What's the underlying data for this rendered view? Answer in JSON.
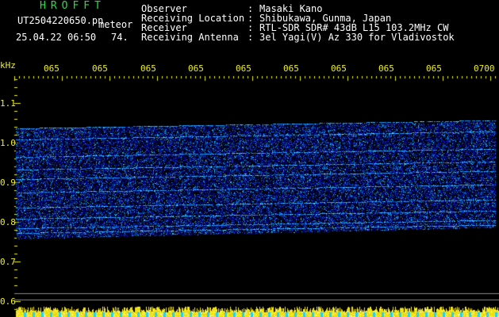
{
  "header": {
    "title": "HROFFT",
    "filename": "UT2504220650.pn",
    "mode": "meteor",
    "datetime": "25.04.22 06:50",
    "count": "74."
  },
  "info": [
    {
      "label": "Observer",
      "value": "Masaki Kano"
    },
    {
      "label": "Receiving Location",
      "value": "Shibukawa, Gunma, Japan"
    },
    {
      "label": "Receiver",
      "value": "RTL-SDR SDR# 43dB L15 103.2MHz CW"
    },
    {
      "label": "Receiving Antenna",
      "value": "3el Yagi(V) Az 330 for Vladivostok"
    }
  ],
  "axis": {
    "y_unit": "kHz",
    "y_ticks": [
      "1.1",
      "1.0",
      "0.9",
      "0.8",
      "0.7",
      "0.6"
    ],
    "x_ticks": [
      "065",
      "065",
      "065",
      "065",
      "065",
      "065",
      "065",
      "065",
      "065",
      "0700"
    ]
  },
  "colors": {
    "background": "#000000",
    "header_green": "#22e040",
    "axis_yellow": "#f0f020",
    "signal_blue": "#1030c0"
  }
}
